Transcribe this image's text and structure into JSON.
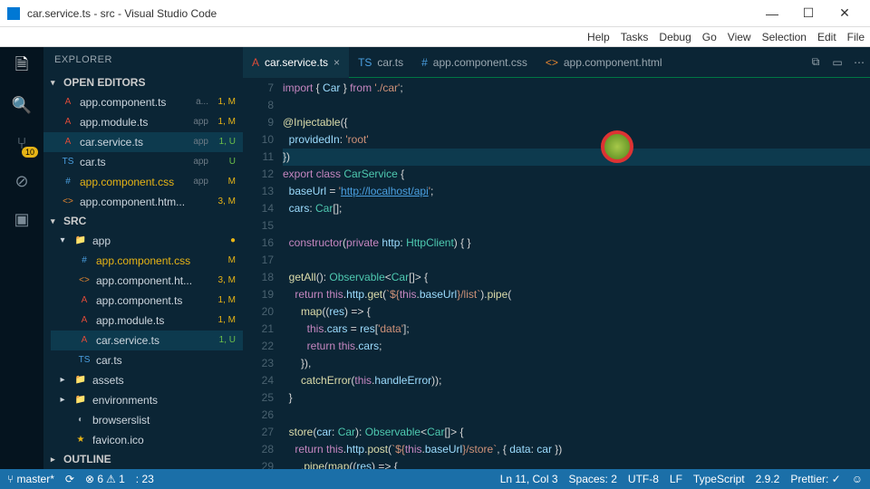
{
  "window": {
    "title": "car.service.ts - src - Visual Studio Code"
  },
  "menu": [
    "Help",
    "Tasks",
    "Debug",
    "Go",
    "View",
    "Selection",
    "Edit",
    "File"
  ],
  "activity": {
    "badge_count": "10"
  },
  "sidebar": {
    "title": "EXPLORER",
    "open_editors_label": "OPEN EDITORS",
    "open_editors": [
      {
        "icon": "A",
        "iconc": "c-red",
        "name": "app.component.ts",
        "dim": "a...",
        "status": "1, M"
      },
      {
        "icon": "A",
        "iconc": "c-red",
        "name": "app.module.ts",
        "dim": "app",
        "status": "1, M"
      },
      {
        "icon": "A",
        "iconc": "c-red",
        "name": "car.service.ts",
        "dim": "app",
        "status": "1, U",
        "sel": true
      },
      {
        "icon": "TS",
        "iconc": "c-blue",
        "name": "car.ts",
        "dim": "app",
        "status": "U"
      },
      {
        "icon": "#",
        "iconc": "c-blue",
        "name": "app.component.css",
        "dim": "app",
        "status": "M",
        "yellow": true
      },
      {
        "icon": "<>",
        "iconc": "c-orange",
        "name": "app.component.htm...",
        "dim": "",
        "status": "3, M"
      }
    ],
    "src_label": "SRC",
    "app_label": "app",
    "app": [
      {
        "icon": "#",
        "iconc": "c-blue",
        "name": "app.component.css",
        "status": "M",
        "yellow": true
      },
      {
        "icon": "<>",
        "iconc": "c-orange",
        "name": "app.component.ht...",
        "status": "3, M"
      },
      {
        "icon": "A",
        "iconc": "c-red",
        "name": "app.component.ts",
        "status": "1, M"
      },
      {
        "icon": "A",
        "iconc": "c-red",
        "name": "app.module.ts",
        "status": "1, M"
      },
      {
        "icon": "A",
        "iconc": "c-red",
        "name": "car.service.ts",
        "status": "1, U",
        "sel": true
      },
      {
        "icon": "TS",
        "iconc": "c-blue",
        "name": "car.ts",
        "status": ""
      }
    ],
    "extra": [
      {
        "icon": "▸",
        "name": "assets",
        "folder": true
      },
      {
        "icon": "▸",
        "name": "environments",
        "folder": true
      },
      {
        "icon": "◐",
        "name": "browserslist"
      },
      {
        "icon": "★",
        "name": "favicon.ico",
        "iconc": "c-yellow"
      }
    ],
    "outline_label": "OUTLINE"
  },
  "tabs": [
    {
      "icon": "A",
      "iconc": "c-red",
      "label": "car.service.ts",
      "active": true,
      "close": true
    },
    {
      "icon": "TS",
      "iconc": "c-blue",
      "label": "car.ts"
    },
    {
      "icon": "#",
      "iconc": "c-blue",
      "label": "app.component.css"
    },
    {
      "icon": "<>",
      "iconc": "c-orange",
      "label": "app.component.html"
    }
  ],
  "code": {
    "start": 7,
    "lines": [
      [
        {
          "k": "import"
        },
        {
          "p": " { "
        },
        {
          "v": "Car"
        },
        {
          "p": " } "
        },
        {
          "k": "from"
        },
        {
          "p": " "
        },
        {
          "s": "'./car'"
        },
        {
          "p": ";"
        }
      ],
      [],
      [
        {
          "f": "@Injectable"
        },
        {
          "p": "({"
        }
      ],
      [
        {
          "p": "  "
        },
        {
          "v": "providedIn"
        },
        {
          "p": ": "
        },
        {
          "s": "'root'"
        }
      ],
      [
        {
          "p": "})"
        }
      ],
      [
        {
          "k": "export"
        },
        {
          "p": " "
        },
        {
          "k": "class"
        },
        {
          "p": " "
        },
        {
          "t": "CarService"
        },
        {
          "p": " {"
        }
      ],
      [
        {
          "p": "  "
        },
        {
          "v": "baseUrl"
        },
        {
          "p": " = "
        },
        {
          "s": "'"
        },
        {
          "a": "http://localhost/api"
        },
        {
          "s": "'"
        },
        {
          "p": ";"
        }
      ],
      [
        {
          "p": "  "
        },
        {
          "v": "cars"
        },
        {
          "p": ": "
        },
        {
          "t": "Car"
        },
        {
          "p": "[];"
        }
      ],
      [],
      [
        {
          "p": "  "
        },
        {
          "k": "constructor"
        },
        {
          "p": "("
        },
        {
          "k": "private"
        },
        {
          "p": " "
        },
        {
          "v": "http"
        },
        {
          "p": ": "
        },
        {
          "t": "HttpClient"
        },
        {
          "p": ") { }"
        }
      ],
      [],
      [
        {
          "p": "  "
        },
        {
          "f": "getAll"
        },
        {
          "p": "(): "
        },
        {
          "t": "Observable"
        },
        {
          "p": "<"
        },
        {
          "t": "Car"
        },
        {
          "p": "[]> {"
        }
      ],
      [
        {
          "p": "    "
        },
        {
          "k": "return"
        },
        {
          "p": " "
        },
        {
          "k": "this"
        },
        {
          "p": "."
        },
        {
          "v": "http"
        },
        {
          "p": "."
        },
        {
          "f": "get"
        },
        {
          "p": "("
        },
        {
          "s": "`${"
        },
        {
          "k": "this"
        },
        {
          "p": "."
        },
        {
          "v": "baseUrl"
        },
        {
          "s": "}/list`"
        },
        {
          "p": ")."
        },
        {
          "f": "pipe"
        },
        {
          "p": "("
        }
      ],
      [
        {
          "p": "      "
        },
        {
          "f": "map"
        },
        {
          "p": "(("
        },
        {
          "v": "res"
        },
        {
          "p": ") => {"
        }
      ],
      [
        {
          "p": "        "
        },
        {
          "k": "this"
        },
        {
          "p": "."
        },
        {
          "v": "cars"
        },
        {
          "p": " = "
        },
        {
          "v": "res"
        },
        {
          "p": "["
        },
        {
          "s": "'data'"
        },
        {
          "p": "];"
        }
      ],
      [
        {
          "p": "        "
        },
        {
          "k": "return"
        },
        {
          "p": " "
        },
        {
          "k": "this"
        },
        {
          "p": "."
        },
        {
          "v": "cars"
        },
        {
          "p": ";"
        }
      ],
      [
        {
          "p": "      }),"
        }
      ],
      [
        {
          "p": "      "
        },
        {
          "f": "catchError"
        },
        {
          "p": "("
        },
        {
          "k": "this"
        },
        {
          "p": "."
        },
        {
          "v": "handleError"
        },
        {
          "p": "));"
        }
      ],
      [
        {
          "p": "  }"
        }
      ],
      [],
      [
        {
          "p": "  "
        },
        {
          "f": "store"
        },
        {
          "p": "("
        },
        {
          "v": "car"
        },
        {
          "p": ": "
        },
        {
          "t": "Car"
        },
        {
          "p": "): "
        },
        {
          "t": "Observable"
        },
        {
          "p": "<"
        },
        {
          "t": "Car"
        },
        {
          "p": "[]> {"
        }
      ],
      [
        {
          "p": "    "
        },
        {
          "k": "return"
        },
        {
          "p": " "
        },
        {
          "k": "this"
        },
        {
          "p": "."
        },
        {
          "v": "http"
        },
        {
          "p": "."
        },
        {
          "f": "post"
        },
        {
          "p": "("
        },
        {
          "s": "`${"
        },
        {
          "k": "this"
        },
        {
          "p": "."
        },
        {
          "v": "baseUrl"
        },
        {
          "s": "}/store`"
        },
        {
          "p": ", { "
        },
        {
          "v": "data"
        },
        {
          "p": ": "
        },
        {
          "v": "car"
        },
        {
          "p": " })"
        }
      ],
      [
        {
          "p": "      ."
        },
        {
          "f": "pipe"
        },
        {
          "p": "("
        },
        {
          "f": "map"
        },
        {
          "p": "(("
        },
        {
          "v": "res"
        },
        {
          "p": ") => {"
        }
      ]
    ],
    "highlight_idx": 4
  },
  "status": {
    "branch": "master*",
    "sync": "⟳",
    "errors": "⊗ 6",
    "warnings": "⚠ 1",
    "line_info": ": 23",
    "pos": "Ln 11, Col 3",
    "spaces": "Spaces: 2",
    "encoding": "UTF-8",
    "eol": "LF",
    "lang": "TypeScript",
    "ver": "2.9.2",
    "prettier": "Prettier: ✓",
    "smile": "☺"
  }
}
